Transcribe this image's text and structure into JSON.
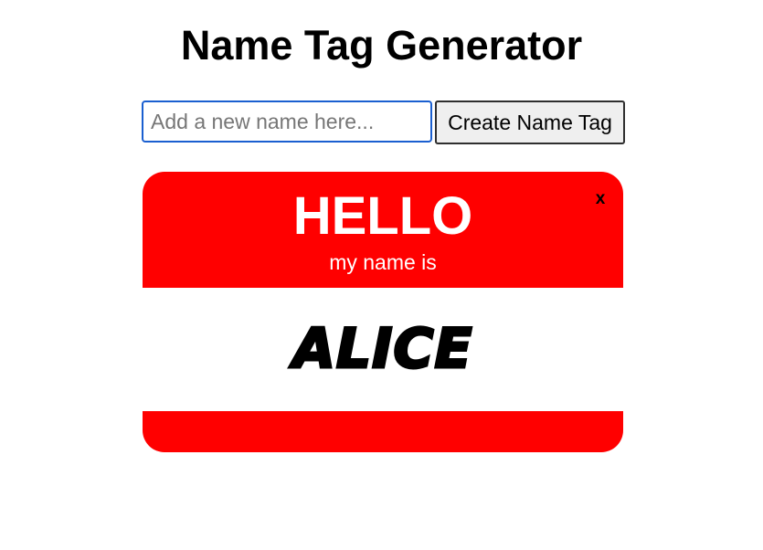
{
  "header": {
    "title": "Name Tag Generator"
  },
  "form": {
    "input_value": "",
    "input_placeholder": "Add a new name here...",
    "submit_label": "Create Name Tag"
  },
  "name_tags": [
    {
      "greeting": "HELLO",
      "subtitle": "my name is",
      "name": "Alice",
      "close_label": "x"
    }
  ],
  "colors": {
    "tag_red": "#ff0000",
    "input_focus_border": "#1a5fd0",
    "button_background": "#efefef"
  }
}
